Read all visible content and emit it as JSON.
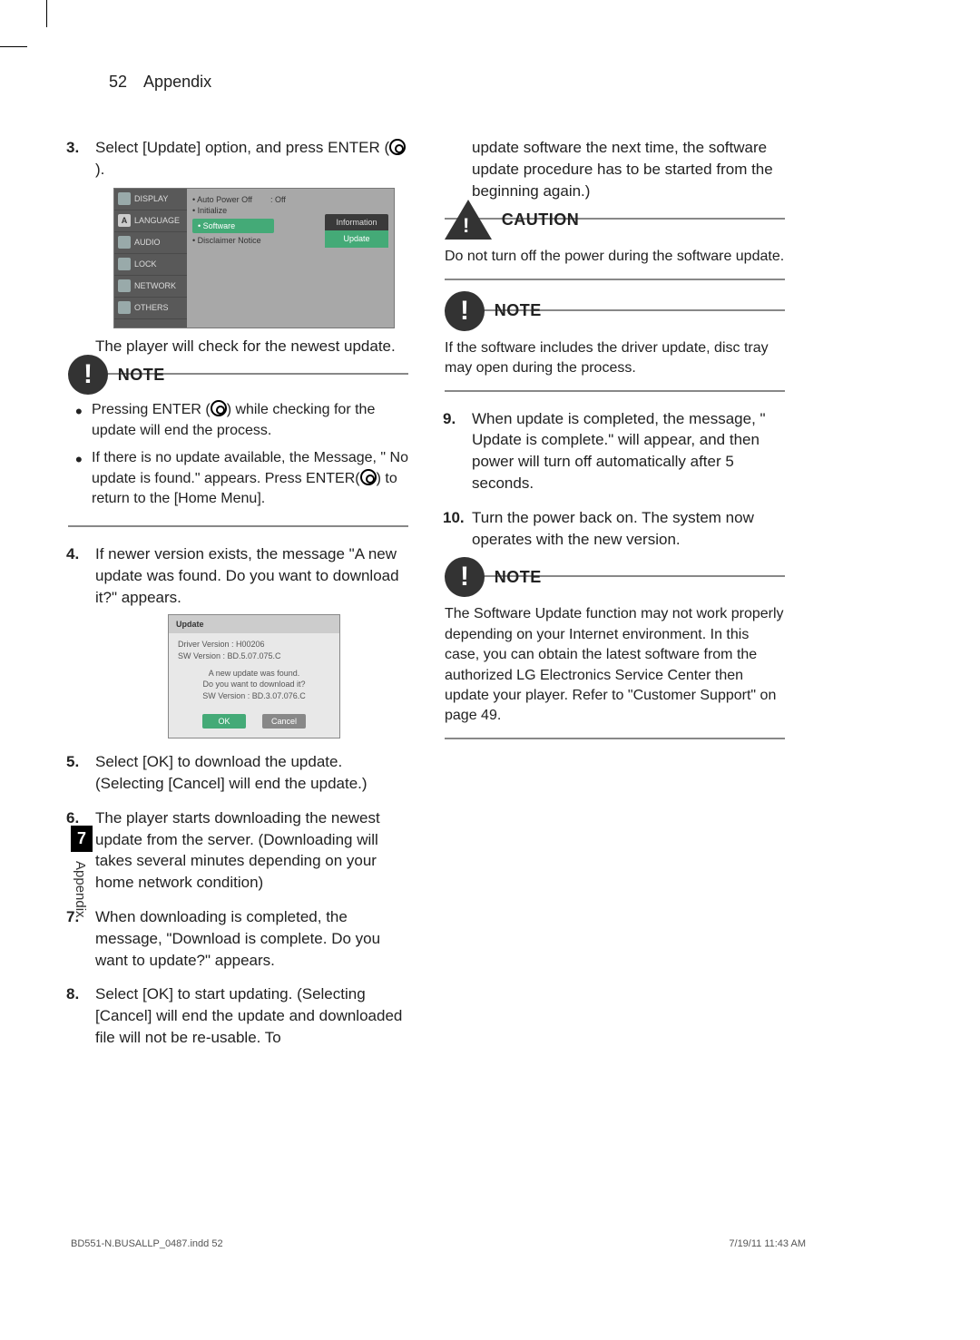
{
  "header": {
    "page_num": "52",
    "section": "Appendix"
  },
  "left": {
    "step3": "Select [Update] option, and press ENTER (",
    "step3_end": ").",
    "ss1_side": [
      "DISPLAY",
      "LANGUAGE",
      "AUDIO",
      "LOCK",
      "NETWORK",
      "OTHERS"
    ],
    "ss1_items": {
      "auto_power": "• Auto Power Off",
      "off": ": Off",
      "initialize": "• Initialize",
      "software": "• Software",
      "disclaimer": "• Disclaimer Notice",
      "flyout1": "Information",
      "flyout2": "Update"
    },
    "after_ss1": "The player will check for the newest update.",
    "note1_title": "NOTE",
    "note1_b1a": "Pressing ENTER (",
    "note1_b1b": ") while checking for the update will end the process.",
    "note1_b2a": "If there is no update available, the Message, \" No update is found.\" appears. Press ENTER(",
    "note1_b2b": ") to return to the [Home Menu].",
    "step4": "If newer version exists, the message \"A new update was found. Do you want to download it?\" appears.",
    "ss2": {
      "title": "Update",
      "l1": "Driver Version : H00206",
      "l2": "SW Version : BD.5.07.075.C",
      "m1": "A new update was found.",
      "m2": "Do you want to download it?",
      "m3": "SW Version : BD.3.07.076.C",
      "ok": "OK",
      "cancel": "Cancel"
    },
    "step5": "Select [OK] to download the update. (Selecting [Cancel] will end the update.)",
    "step6": "The player starts downloading the newest update from the server. (Downloading will takes several minutes depending on your home network condition)",
    "step7": "When downloading is completed, the message, \"Download is complete. Do you want to update?\" appears.",
    "step8": "Select [OK] to start updating. (Selecting [Cancel] will end the update and downloaded file will not be re-usable. To"
  },
  "right": {
    "cont": "update software the next time, the software update procedure has to be started from the beginning again.)",
    "caution_title": "CAUTION",
    "caution_text": "Do not turn off the power during the software update.",
    "note2_title": "NOTE",
    "note2_text": "If the software includes the driver update, disc tray may open during the process.",
    "step9": "When update is completed, the message, \" Update is complete.\" will appear, and then power will turn off automatically after 5 seconds.",
    "step10": "Turn the power back on. The system now operates with the new version.",
    "note3_title": "NOTE",
    "note3_text": "The Software Update function may not work properly depending on your Internet environment. In this case, you can obtain the latest software from the authorized LG Electronics Service Center then update your player. Refer to \"Customer Support\" on page 49."
  },
  "sidetab": {
    "num": "7",
    "label": "Appendix"
  },
  "footer": {
    "file": "BD551-N.BUSALLP_0487.indd   52",
    "stamp": "7/19/11   11:43 AM"
  }
}
